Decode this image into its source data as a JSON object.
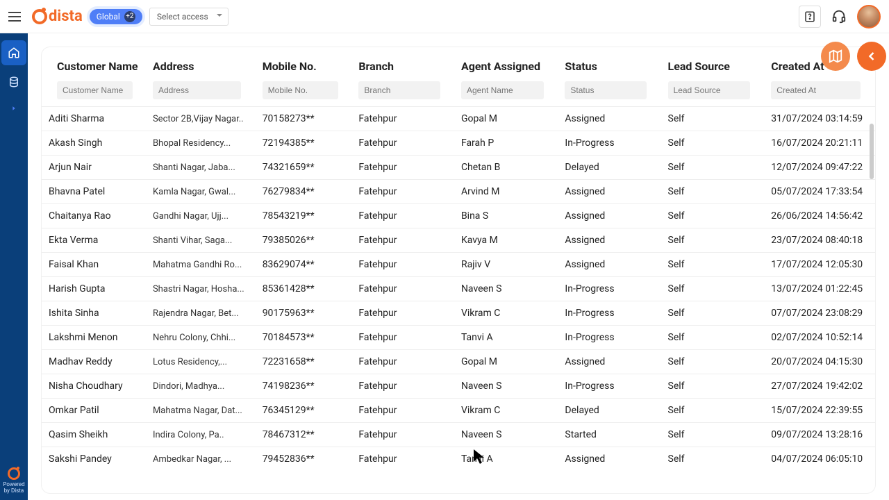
{
  "header": {
    "brand": "dista",
    "chip_label": "Global",
    "chip_badge": "+2",
    "access_placeholder": "Select access"
  },
  "sidebar": {
    "powered_line1": "Powered",
    "powered_line2": "by Dista"
  },
  "table": {
    "columns": [
      {
        "label": "Customer Name",
        "placeholder": "Customer Name"
      },
      {
        "label": "Address",
        "placeholder": "Address"
      },
      {
        "label": "Mobile No.",
        "placeholder": "Mobile No."
      },
      {
        "label": "Branch",
        "placeholder": "Branch"
      },
      {
        "label": "Agent Assigned",
        "placeholder": "Agent Name"
      },
      {
        "label": "Status",
        "placeholder": "Status"
      },
      {
        "label": "Lead Source",
        "placeholder": "Lead Source"
      },
      {
        "label": "Created At",
        "placeholder": "Created At"
      }
    ],
    "rows": [
      {
        "name": "Aditi Sharma",
        "address": "Sector 2B,Vijay Nagar..",
        "mobile": "70158273**",
        "branch": "Fatehpur",
        "agent": "Gopal M",
        "status": "Assigned",
        "source": "Self",
        "created": "31/07/2024 03:14:59"
      },
      {
        "name": "Akash Singh",
        "address": "Bhopal Residency...",
        "mobile": "72194385**",
        "branch": "Fatehpur",
        "agent": "Farah P",
        "status": "In-Progress",
        "source": "Self",
        "created": "16/07/2024 20:21:11"
      },
      {
        "name": "Arjun Nair",
        "address": "Shanti Nagar, Jaba...",
        "mobile": "74321659**",
        "branch": "Fatehpur",
        "agent": "Chetan B",
        "status": "Delayed",
        "source": "Self",
        "created": "12/07/2024 09:47:22"
      },
      {
        "name": "Bhavna Patel",
        "address": "Kamla Nagar, Gwal...",
        "mobile": "76279834**",
        "branch": "Fatehpur",
        "agent": "Arvind M",
        "status": "Assigned",
        "source": "Self",
        "created": "05/07/2024 17:33:54"
      },
      {
        "name": "Chaitanya Rao",
        "address": "Gandhi Nagar, Ujj...",
        "mobile": "78543219**",
        "branch": "Fatehpur",
        "agent": "Bina S",
        "status": "Assigned",
        "source": "Self",
        "created": "26/06/2024 14:56:42"
      },
      {
        "name": "Ekta Verma",
        "address": "Shanti Vihar, Saga...",
        "mobile": "79385026**",
        "branch": "Fatehpur",
        "agent": "Kavya M",
        "status": "Assigned",
        "source": "Self",
        "created": "23/07/2024 08:40:18"
      },
      {
        "name": "Faisal Khan",
        "address": "Mahatma Gandhi Ro...",
        "mobile": "83629074**",
        "branch": "Fatehpur",
        "agent": "Rajiv V",
        "status": "Assigned",
        "source": "Self",
        "created": "17/07/2024 12:05:30"
      },
      {
        "name": "Harish Gupta",
        "address": "Shastri Nagar, Hosha...",
        "mobile": "85361428**",
        "branch": "Fatehpur",
        "agent": "Naveen S",
        "status": "In-Progress",
        "source": "Self",
        "created": "13/07/2024 01:22:45"
      },
      {
        "name": "Ishita Sinha",
        "address": "Rajendra Nagar, Bet...",
        "mobile": "90175963**",
        "branch": "Fatehpur",
        "agent": "Vikram C",
        "status": "In-Progress",
        "source": "Self",
        "created": "07/07/2024 23:08:29"
      },
      {
        "name": "Lakshmi Menon",
        "address": "Nehru Colony, Chhi...",
        "mobile": "70184573**",
        "branch": "Fatehpur",
        "agent": "Tanvi A",
        "status": "In-Progress",
        "source": "Self",
        "created": "02/07/2024 10:52:14"
      },
      {
        "name": "Madhav Reddy",
        "address": "Lotus Residency,...",
        "mobile": "72231658**",
        "branch": "Fatehpur",
        "agent": "Gopal M",
        "status": "Assigned",
        "source": "Self",
        "created": "20/07/2024 04:15:30"
      },
      {
        "name": "Nisha Choudhary",
        "address": "Dindori, Madhya...",
        "mobile": "74198236**",
        "branch": "Fatehpur",
        "agent": "Naveen S",
        "status": "In-Progress",
        "source": "Self",
        "created": "27/07/2024 19:42:02"
      },
      {
        "name": "Omkar Patil",
        "address": "Mahatma Nagar, Dat...",
        "mobile": "76345129**",
        "branch": "Fatehpur",
        "agent": "Vikram C",
        "status": "Delayed",
        "source": "Self",
        "created": "15/07/2024 22:39:55"
      },
      {
        "name": "Qasim Sheikh",
        "address": "Indira Colony, Pa..",
        "mobile": "78467312**",
        "branch": "Fatehpur",
        "agent": "Naveen S",
        "status": "Started",
        "source": "Self",
        "created": "09/07/2024 13:28:16"
      },
      {
        "name": "Sakshi Pandey",
        "address": "Ambedkar Nagar, ...",
        "mobile": "79452836**",
        "branch": "Fatehpur",
        "agent": "Tanvi A",
        "status": "Assigned",
        "source": "Self",
        "created": "04/07/2024 06:05:10"
      }
    ]
  }
}
